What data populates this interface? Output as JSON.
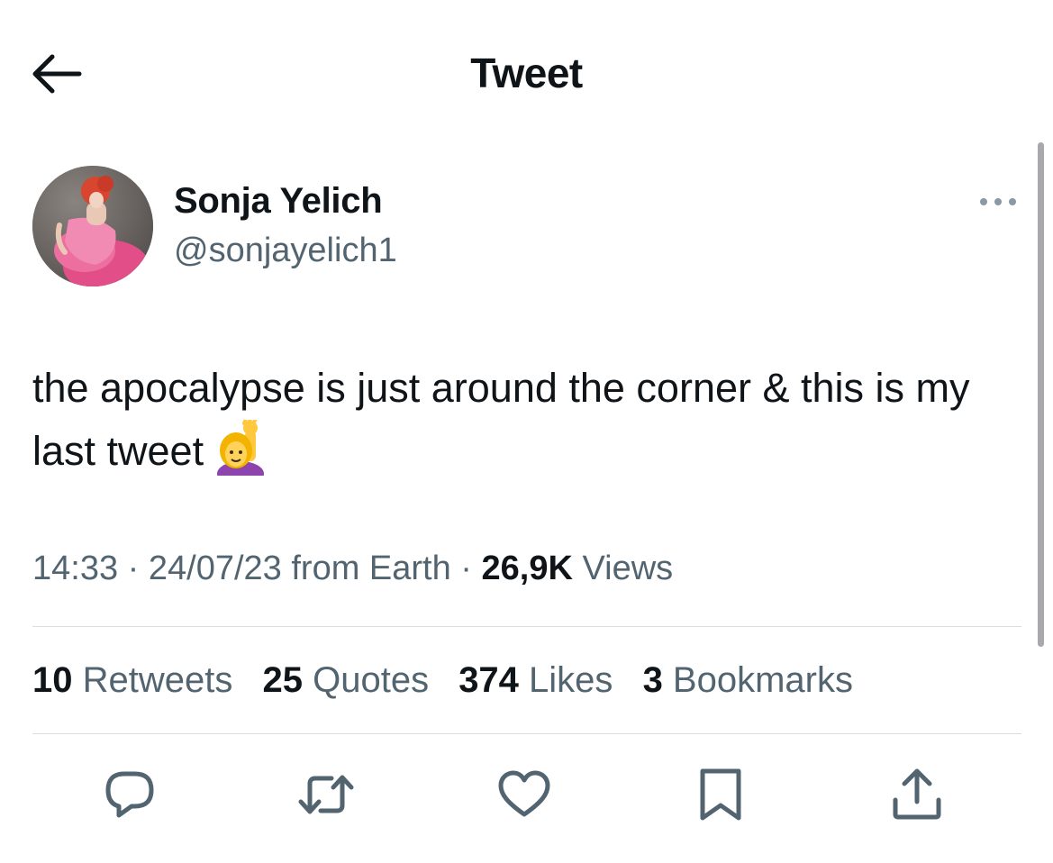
{
  "header": {
    "title": "Tweet",
    "back_icon": "arrow-left-icon"
  },
  "tweet": {
    "author": {
      "display_name": "Sonja Yelich",
      "handle": "@sonjayelich1"
    },
    "more_icon": "more-horizontal-icon",
    "text": "the apocalypse is just around the corner & this is my last tweet",
    "emoji": "woman-raising-hand-emoji",
    "time": "14:33",
    "sep1": " · ",
    "date": "24/07/23",
    "source": " from Earth",
    "sep2": " · ",
    "views_count": "26,9K",
    "views_label": " Views"
  },
  "stats": {
    "retweets_count": "10",
    "retweets_label": " Retweets",
    "quotes_count": "25",
    "quotes_label": " Quotes",
    "likes_count": "374",
    "likes_label": " Likes",
    "bookmarks_count": "3",
    "bookmarks_label": " Bookmarks"
  },
  "actions": [
    "reply-icon",
    "retweet-icon",
    "like-icon",
    "bookmark-icon",
    "share-icon"
  ],
  "colors": {
    "text": "#0f1419",
    "secondary": "#536471",
    "divider": "#d9dee2"
  }
}
